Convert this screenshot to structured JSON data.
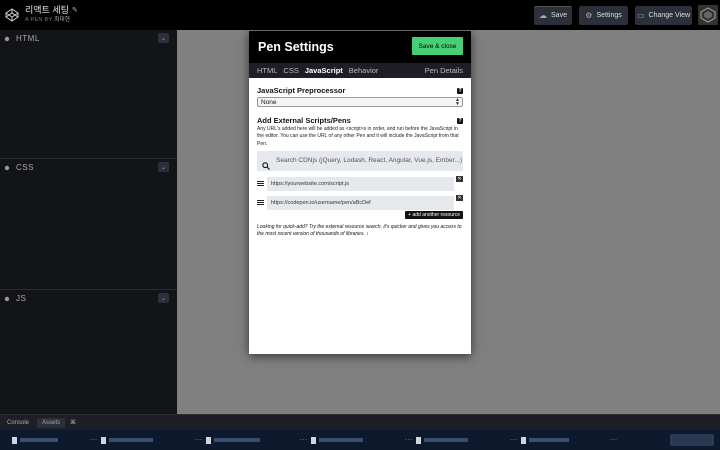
{
  "header": {
    "pen_title": "리액트 세팅",
    "by_label": "A PEN BY",
    "author": "최대현",
    "buttons": {
      "save": "Save",
      "settings": "Settings",
      "change_view": "Change View"
    }
  },
  "editors": [
    {
      "label": "HTML"
    },
    {
      "label": "CSS"
    },
    {
      "label": "JS"
    }
  ],
  "bottombar": {
    "console": "Console",
    "assets": "Assets",
    "shortcut": "⌘"
  },
  "modal": {
    "title": "Pen Settings",
    "save_close": "Save & close",
    "tabs": [
      "HTML",
      "CSS",
      "JavaScript",
      "Behavior"
    ],
    "active_tab": "JavaScript",
    "details_tab": "Pen Details",
    "preprocessor": {
      "title": "JavaScript Preprocessor",
      "selected": "None"
    },
    "external": {
      "title": "Add External Scripts/Pens",
      "description": "Any URL's added here will be added as <script>s in order, and run before the JavaScript in the editor. You can use the URL of any other Pen and it will include the JavaScript from that Pen.",
      "search_placeholder": "Search CDNjs (jQuery, Lodash, React, Angular, Vue.js, Ember...)",
      "resources": [
        {
          "placeholder": "https://yourwebsite.com/script.js"
        },
        {
          "placeholder": "https://codepen.io/username/pen/aBcDef"
        }
      ],
      "add_label": "+ add another resource",
      "quick_add": "Looking for quick-add? Try the external resource search, it's quicker and gives you access to the most recent version of thousands of libraries. ↕"
    }
  },
  "colors": {
    "accent_green": "#47cf73",
    "preview_gray": "#808080",
    "editor_bg": "#131417",
    "chrome_bg": "#1e1f26"
  }
}
